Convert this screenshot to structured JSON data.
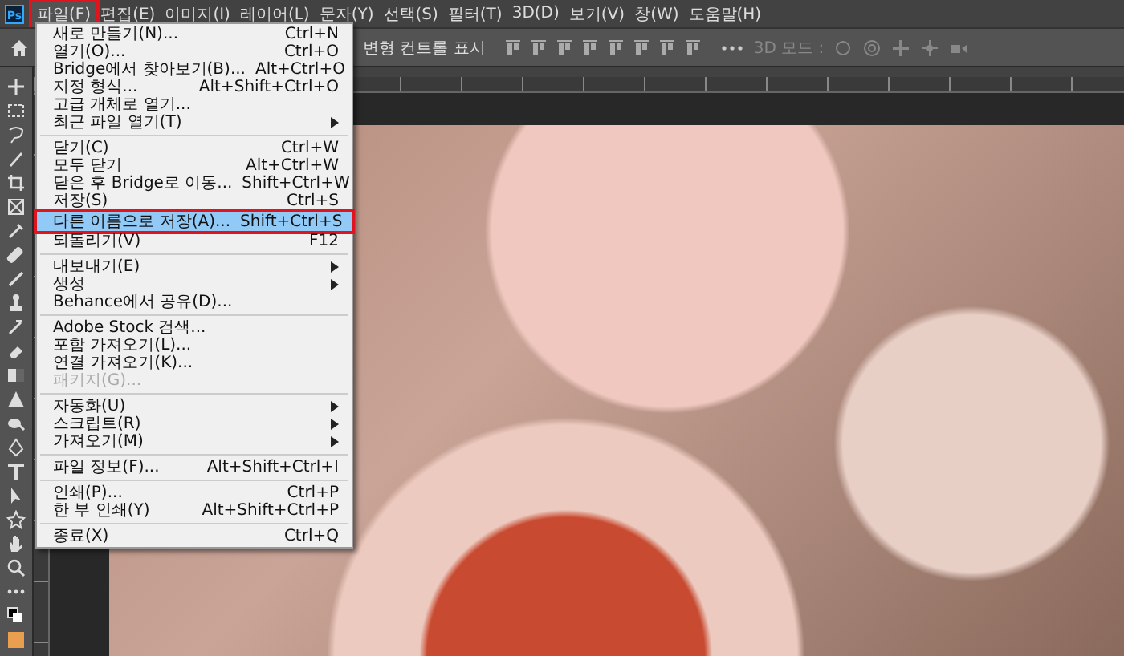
{
  "app_logo": "Ps",
  "menu_bar": [
    {
      "label": "파일(F)",
      "selected": true
    },
    {
      "label": "편집(E)",
      "selected": false
    },
    {
      "label": "이미지(I)",
      "selected": false
    },
    {
      "label": "레이어(L)",
      "selected": false
    },
    {
      "label": "문자(Y)",
      "selected": false
    },
    {
      "label": "선택(S)",
      "selected": false
    },
    {
      "label": "필터(T)",
      "selected": false
    },
    {
      "label": "3D(D)",
      "selected": false
    },
    {
      "label": "보기(V)",
      "selected": false
    },
    {
      "label": "창(W)",
      "selected": false
    },
    {
      "label": "도움말(H)",
      "selected": false
    }
  ],
  "options_bar": {
    "transform_controls_label": "변형 컨트롤 표시",
    "mode_3d_label": "3D 모드 :"
  },
  "file_menu": [
    {
      "kind": "item",
      "label": "새로 만들기(N)...",
      "shortcut": "Ctrl+N",
      "disabled": false,
      "selected": false
    },
    {
      "kind": "item",
      "label": "열기(O)...",
      "shortcut": "Ctrl+O",
      "disabled": false,
      "selected": false
    },
    {
      "kind": "item",
      "label": "Bridge에서 찾아보기(B)...",
      "shortcut": "Alt+Ctrl+O",
      "disabled": false,
      "selected": false
    },
    {
      "kind": "item",
      "label": "지정 형식...",
      "shortcut": "Alt+Shift+Ctrl+O",
      "disabled": false,
      "selected": false
    },
    {
      "kind": "item",
      "label": "고급 개체로 열기...",
      "disabled": false,
      "selected": false
    },
    {
      "kind": "item",
      "label": "최근 파일 열기(T)",
      "submenu": true,
      "disabled": false,
      "selected": false
    },
    {
      "kind": "separator"
    },
    {
      "kind": "item",
      "label": "닫기(C)",
      "shortcut": "Ctrl+W",
      "disabled": false,
      "selected": false
    },
    {
      "kind": "item",
      "label": "모두 닫기",
      "shortcut": "Alt+Ctrl+W",
      "disabled": false,
      "selected": false
    },
    {
      "kind": "item",
      "label": "닫은 후 Bridge로 이동...",
      "shortcut": "Shift+Ctrl+W",
      "disabled": false,
      "selected": false
    },
    {
      "kind": "item",
      "label": "저장(S)",
      "shortcut": "Ctrl+S",
      "disabled": false,
      "selected": false
    },
    {
      "kind": "item",
      "label": "다른 이름으로 저장(A)...",
      "shortcut": "Shift+Ctrl+S",
      "disabled": false,
      "selected": true
    },
    {
      "kind": "item",
      "label": "되돌리기(V)",
      "shortcut": "F12",
      "disabled": false,
      "selected": false
    },
    {
      "kind": "separator"
    },
    {
      "kind": "item",
      "label": "내보내기(E)",
      "submenu": true,
      "disabled": false,
      "selected": false
    },
    {
      "kind": "item",
      "label": "생성",
      "submenu": true,
      "disabled": false,
      "selected": false
    },
    {
      "kind": "item",
      "label": "Behance에서 공유(D)...",
      "disabled": false,
      "selected": false
    },
    {
      "kind": "separator"
    },
    {
      "kind": "item",
      "label": "Adobe Stock 검색...",
      "disabled": false,
      "selected": false
    },
    {
      "kind": "item",
      "label": "포함 가져오기(L)...",
      "disabled": false,
      "selected": false
    },
    {
      "kind": "item",
      "label": "연결 가져오기(K)...",
      "disabled": false,
      "selected": false
    },
    {
      "kind": "item",
      "label": "패키지(G)...",
      "disabled": true,
      "selected": false
    },
    {
      "kind": "separator"
    },
    {
      "kind": "item",
      "label": "자동화(U)",
      "submenu": true,
      "disabled": false,
      "selected": false
    },
    {
      "kind": "item",
      "label": "스크립트(R)",
      "submenu": true,
      "disabled": false,
      "selected": false
    },
    {
      "kind": "item",
      "label": "가져오기(M)",
      "submenu": true,
      "disabled": false,
      "selected": false
    },
    {
      "kind": "separator"
    },
    {
      "kind": "item",
      "label": "파일 정보(F)...",
      "shortcut": "Alt+Shift+Ctrl+I",
      "disabled": false,
      "selected": false
    },
    {
      "kind": "separator"
    },
    {
      "kind": "item",
      "label": "인쇄(P)...",
      "shortcut": "Ctrl+P",
      "disabled": false,
      "selected": false
    },
    {
      "kind": "item",
      "label": "한 부 인쇄(Y)",
      "shortcut": "Alt+Shift+Ctrl+P",
      "disabled": false,
      "selected": false
    },
    {
      "kind": "separator"
    },
    {
      "kind": "item",
      "label": "종료(X)",
      "shortcut": "Ctrl+Q",
      "disabled": false,
      "selected": false
    }
  ]
}
